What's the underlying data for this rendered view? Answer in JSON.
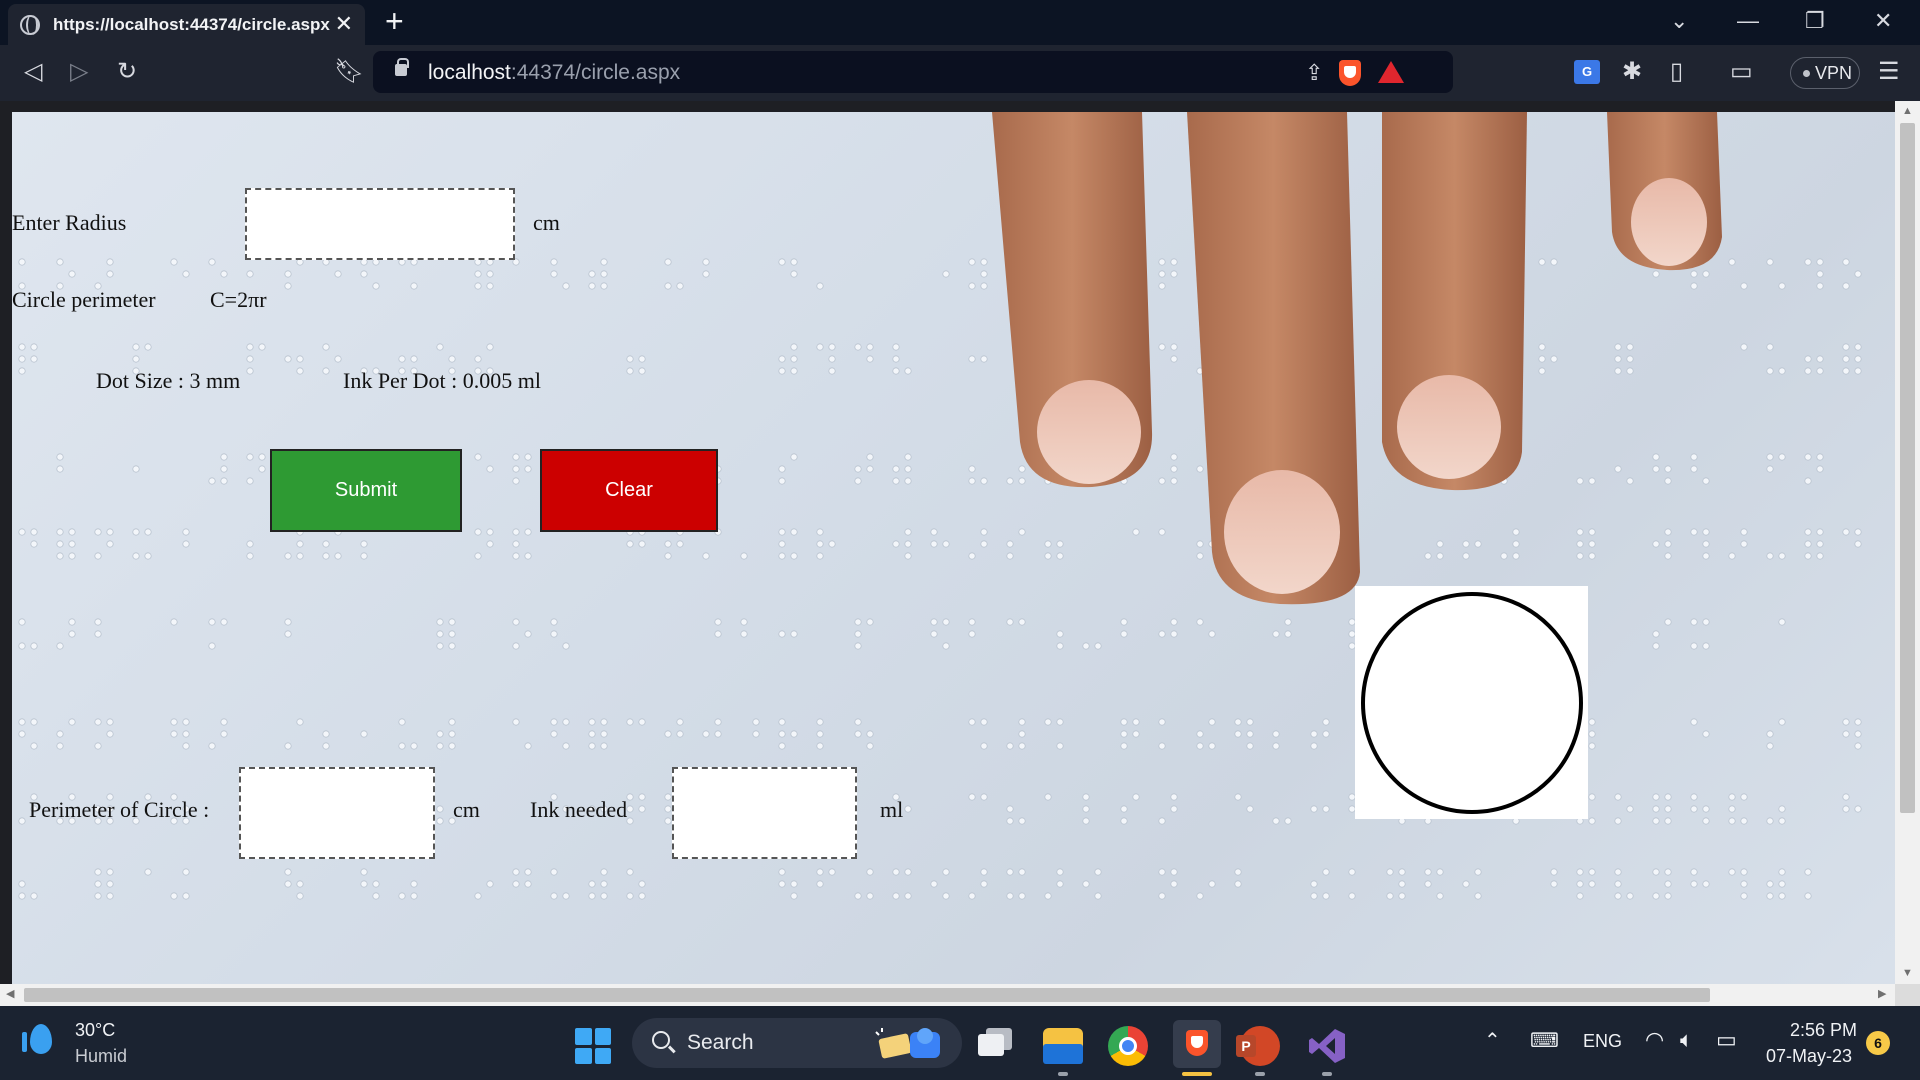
{
  "browser": {
    "tab_title": "https://localhost:44374/circle.aspx",
    "tab_close": "✕",
    "new_tab": "+",
    "url_host": "localhost",
    "url_rest": ":44374/circle.aspx",
    "vpn_label": "VPN",
    "translate_label": "G"
  },
  "page": {
    "radius_label": "Enter Radius",
    "radius_unit": "cm",
    "radius_value": "",
    "perimeter_formula_label": "Circle perimeter",
    "perimeter_formula": "C=2πr",
    "dot_size": "Dot Size :  3 mm",
    "ink_per_dot": "Ink Per Dot : 0.005 ml",
    "submit_label": "Submit",
    "clear_label": "Clear",
    "perimeter_result_label": "Perimeter of Circle  :",
    "perimeter_result_unit": "cm",
    "perimeter_result_value": "",
    "ink_needed_label": "Ink needed",
    "ink_needed_unit": "ml",
    "ink_needed_value": ""
  },
  "taskbar": {
    "temperature": "30°C",
    "weather": "Humid",
    "search_label": "Search",
    "language": "ENG",
    "time": "2:56 PM",
    "date": "07-May-23",
    "notification_count": "6"
  },
  "colors": {
    "submit": "#2e9a33",
    "clear": "#cc0000",
    "tabbar": "#0c1423",
    "toolbar": "#1f2430",
    "taskbar": "#1b2331"
  }
}
